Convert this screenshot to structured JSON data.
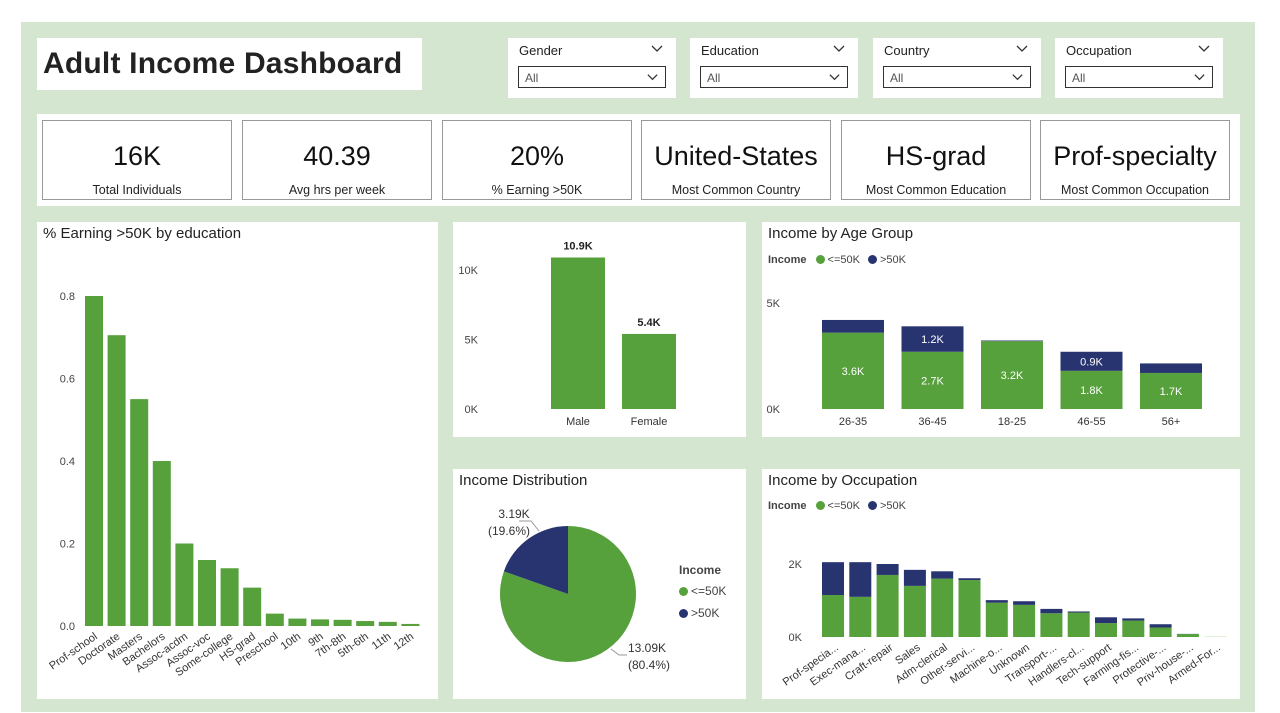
{
  "dashboard": {
    "title": "Adult Income Dashboard"
  },
  "slicers": [
    {
      "label": "Gender",
      "value": "All"
    },
    {
      "label": "Education",
      "value": "All"
    },
    {
      "label": "Country",
      "value": "All"
    },
    {
      "label": "Occupation",
      "value": "All"
    }
  ],
  "kpis": [
    {
      "value": "16K",
      "caption": "Total Individuals"
    },
    {
      "value": "40.39",
      "caption": "Avg hrs per week"
    },
    {
      "value": "20%",
      "caption": "% Earning >50K"
    },
    {
      "value": "United-States",
      "caption": "Most Common Country"
    },
    {
      "value": "HS-grad",
      "caption": "Most Common Education"
    },
    {
      "value": "Prof-specialty",
      "caption": "Most Common Occupation"
    }
  ],
  "colors": {
    "le50k": "#56a13b",
    "gt50k": "#283470",
    "background": "#d4e6cf"
  },
  "legend": {
    "title": "Income",
    "le50k": "<=50K",
    "gt50k": ">50K"
  },
  "chart_data": [
    {
      "type": "bar",
      "title": "% Earning >50K by education",
      "categories": [
        "Prof-school",
        "Doctorate",
        "Masters",
        "Bachelors",
        "Assoc-acdm",
        "Assoc-voc",
        "Some-college",
        "HS-grad",
        "Preschool",
        "10th",
        "9th",
        "7th-8th",
        "5th-6th",
        "11th",
        "12th"
      ],
      "values": [
        0.8,
        0.705,
        0.55,
        0.4,
        0.2,
        0.16,
        0.14,
        0.093,
        0.03,
        0.018,
        0.016,
        0.015,
        0.012,
        0.01,
        0.005
      ],
      "yticks": [
        "0.0",
        "0.2",
        "0.4",
        "0.6",
        "0.8"
      ],
      "ylim": [
        0,
        0.8
      ]
    },
    {
      "type": "bar",
      "title": "",
      "categories": [
        "Male",
        "Female"
      ],
      "values": [
        10900,
        5400
      ],
      "data_labels": [
        "10.9K",
        "5.4K"
      ],
      "yticks": [
        "0K",
        "5K",
        "10K"
      ],
      "ylim": [
        0,
        10000
      ]
    },
    {
      "type": "bar",
      "stacked": true,
      "title": "Income by Age Group",
      "categories": [
        "26-35",
        "36-45",
        "18-25",
        "46-55",
        "56+"
      ],
      "series": [
        {
          "name": "<=50K",
          "values": [
            3600,
            2700,
            3200,
            1800,
            1700
          ],
          "labels": [
            "3.6K",
            "2.7K",
            "3.2K",
            "1.8K",
            "1.7K"
          ]
        },
        {
          "name": ">50K",
          "values": [
            600,
            1200,
            30,
            900,
            450
          ],
          "labels": [
            "",
            "1.2K",
            "",
            "0.9K",
            ""
          ]
        }
      ],
      "yticks": [
        "0K",
        "5K"
      ],
      "ylim": [
        0,
        5000
      ]
    },
    {
      "type": "pie",
      "title": "Income Distribution",
      "slices": [
        {
          "name": "<=50K",
          "value": 13090,
          "label": "13.09K",
          "pct": "(80.4%)"
        },
        {
          "name": ">50K",
          "value": 3190,
          "label": "3.19K",
          "pct": "(19.6%)"
        }
      ]
    },
    {
      "type": "bar",
      "stacked": true,
      "title": "Income by Occupation",
      "categories": [
        "Prof-specia...",
        "Exec-mana...",
        "Craft-repair",
        "Sales",
        "Adm-clerical",
        "Other-servi...",
        "Machine-o...",
        "Unknown",
        "Transport-...",
        "Handlers-cl...",
        "Tech-support",
        "Farming-fis...",
        "Protective-...",
        "Priv-house-...",
        "Armed-For..."
      ],
      "series": [
        {
          "name": "<=50K",
          "values": [
            1150,
            1100,
            1700,
            1400,
            1600,
            1560,
            940,
            880,
            650,
            670,
            380,
            450,
            260,
            80,
            5
          ]
        },
        {
          "name": ">50K",
          "values": [
            900,
            950,
            300,
            440,
            200,
            50,
            70,
            100,
            120,
            30,
            160,
            60,
            90,
            5,
            0
          ]
        }
      ],
      "yticks": [
        "0K",
        "2K"
      ],
      "ylim": [
        0,
        2000
      ]
    }
  ]
}
